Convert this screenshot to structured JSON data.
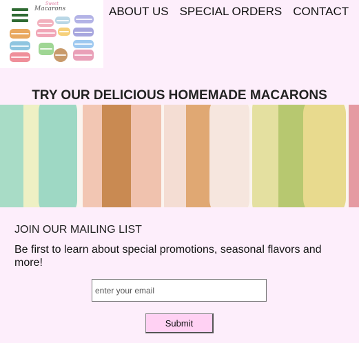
{
  "logo": {
    "script_title": "Macarons",
    "script_sub": "Sweet"
  },
  "nav": {
    "items": [
      {
        "label": "ABOUT US"
      },
      {
        "label": "SPECIAL ORDERS"
      },
      {
        "label": "CONTACT"
      }
    ]
  },
  "hero": {
    "headline": "TRY OUR DELICIOUS HOMEMADE MACARONS"
  },
  "mailing": {
    "title": "JOIN OUR MAILING LIST",
    "text": "Be first to learn about special promotions, seasonal flavors and more!",
    "email_placeholder": "enter your email",
    "submit_label": "Submit"
  },
  "colors": {
    "background": "#fdeefb",
    "button": "#ffd1f3",
    "menu_icon": "#2f6b33"
  }
}
